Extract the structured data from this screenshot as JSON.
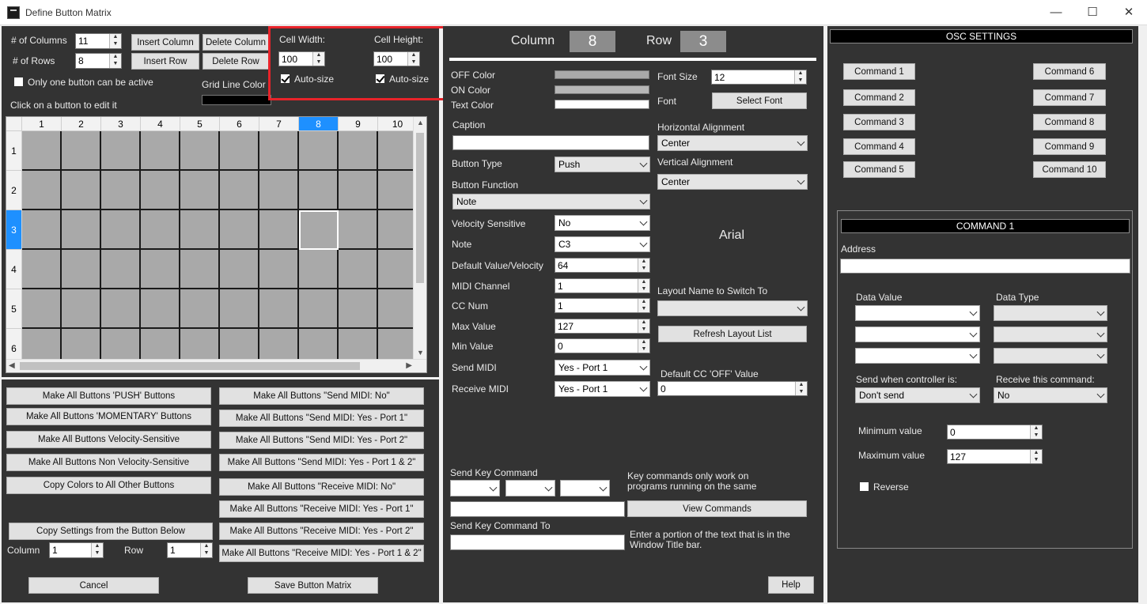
{
  "window": {
    "title": "Define Button Matrix",
    "minimize": "—",
    "maximize": "☐",
    "close": "✕"
  },
  "left": {
    "columns_label": "# of Columns",
    "columns_value": "11",
    "rows_label": "# of Rows",
    "rows_value": "8",
    "insert_column": "Insert Column",
    "delete_column": "Delete Column",
    "insert_row": "Insert Row",
    "delete_row": "Delete Row",
    "only_one_label": "Only one button can be active",
    "grid_line_color_label": "Grid Line Color",
    "click_hint": "Click on a button to edit it",
    "cell_width_label": "Cell Width:",
    "cell_width_value": "100",
    "cell_height_label": "Cell Height:",
    "cell_height_value": "100",
    "autosize_label": "Auto-size",
    "grid_col_headers": [
      "1",
      "2",
      "3",
      "4",
      "5",
      "6",
      "7",
      "8",
      "9",
      "10"
    ],
    "grid_row_headers": [
      "1",
      "2",
      "3",
      "4",
      "5",
      "6"
    ],
    "selected_col": "8",
    "selected_row": "3"
  },
  "bulk": {
    "push": "Make All Buttons 'PUSH' Buttons",
    "momentary": "Make All Buttons 'MOMENTARY' Buttons",
    "velocity": "Make All Buttons Velocity-Sensitive",
    "non_velocity": "Make All Buttons Non Velocity-Sensitive",
    "copy_colors": "Copy Colors to All Other Buttons",
    "send_no": "Make All Buttons \"Send MIDI: No\"",
    "send_p1": "Make All Buttons \"Send MIDI: Yes - Port 1\"",
    "send_p2": "Make All Buttons \"Send MIDI: Yes - Port 2\"",
    "send_p12": "Make All Buttons \"Send MIDI: Yes - Port 1 & 2\"",
    "recv_no": "Make All Buttons \"Receive MIDI: No\"",
    "recv_p1": "Make All Buttons \"Receive MIDI: Yes - Port 1\"",
    "recv_p2": "Make All Buttons \"Receive MIDI: Yes - Port 2\"",
    "recv_p12": "Make All Buttons \"Receive MIDI: Yes - Port 1 & 2\"",
    "copy_settings": "Copy Settings from the Button Below",
    "column_label": "Column",
    "column_value": "1",
    "row_label": "Row",
    "row_value": "1",
    "cancel": "Cancel",
    "save": "Save Button Matrix"
  },
  "mid": {
    "column_label": "Column",
    "column_value": "8",
    "row_label": "Row",
    "row_value": "3",
    "off_color": "OFF Color",
    "on_color": "ON Color",
    "text_color": "Text Color",
    "caption_label": "Caption",
    "caption_value": "",
    "font_size_label": "Font Size",
    "font_size_value": "12",
    "font_label": "Font",
    "select_font": "Select Font",
    "halign_label": "Horizontal Alignment",
    "halign_value": "Center",
    "valign_label": "Vertical Alignment",
    "valign_value": "Center",
    "font_preview": "Arial",
    "button_type_label": "Button Type",
    "button_type_value": "Push",
    "button_function_label": "Button Function",
    "button_function_value": "Note",
    "velocity_label": "Velocity Sensitive",
    "velocity_value": "No",
    "note_label": "Note",
    "note_value": "C3",
    "default_vel_label": "Default Value/Velocity",
    "default_vel_value": "64",
    "midi_channel_label": "MIDI Channel",
    "midi_channel_value": "1",
    "cc_num_label": "CC Num",
    "cc_num_value": "1",
    "max_label": "Max Value",
    "max_value": "127",
    "min_label": "Min Value",
    "min_value": "0",
    "send_midi_label": "Send MIDI",
    "send_midi_value": "Yes - Port 1",
    "recv_midi_label": "Receive MIDI",
    "recv_midi_value": "Yes - Port 1",
    "layout_switch_label": "Layout Name to Switch To",
    "refresh_layout": "Refresh Layout List",
    "default_cc_label": "Default CC 'OFF' Value",
    "default_cc_value": "0",
    "send_key_label": "Send Key Command",
    "key_note": "Key commands only work on programs running on the same",
    "view_commands": "View Commands",
    "send_key_to_label": "Send Key Command To",
    "send_key_to_note": "Enter a portion of the text that is in the Window Title bar.",
    "help": "Help"
  },
  "osc": {
    "title": "OSC SETTINGS",
    "commands": [
      "Command 1",
      "Command 2",
      "Command 3",
      "Command 4",
      "Command 5",
      "Command 6",
      "Command 7",
      "Command 8",
      "Command 9",
      "Command 10"
    ],
    "command_title": "COMMAND 1",
    "address_label": "Address",
    "data_value_label": "Data Value",
    "data_type_label": "Data Type",
    "send_when_label": "Send when controller is:",
    "send_when_value": "Don't send",
    "receive_label": "Receive this command:",
    "receive_value": "No",
    "min_label": "Minimum value",
    "min_value": "0",
    "max_label": "Maximum value",
    "max_value": "127",
    "reverse_label": "Reverse"
  }
}
